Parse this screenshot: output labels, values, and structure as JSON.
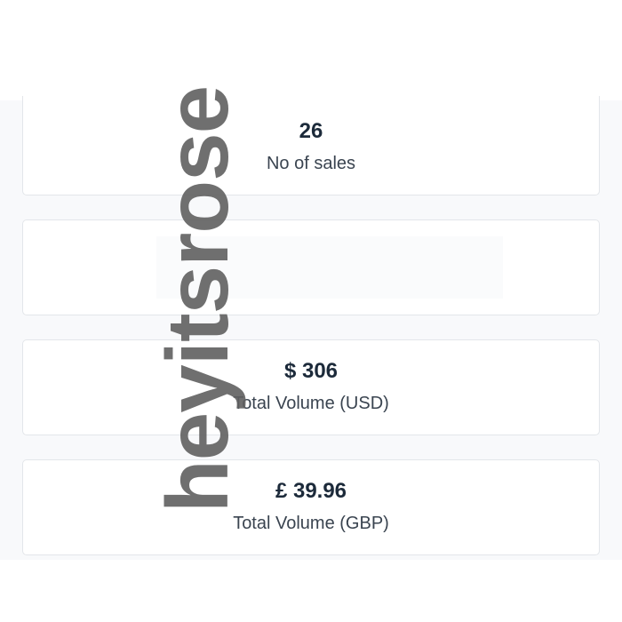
{
  "stats": [
    {
      "value": "26",
      "label": "No of sales"
    },
    {
      "value": "",
      "label": ""
    },
    {
      "value": "$ 306",
      "label": "Total Volume (USD)"
    },
    {
      "value": "£ 39.96",
      "label": "Total Volume (GBP)"
    }
  ],
  "watermark": {
    "text": "heyitsrose"
  },
  "colors": {
    "background": "#f8f9fb",
    "card": "#ffffff",
    "card_border": "#e3e6ea",
    "value_text": "#1c2a3a",
    "label_text": "#3a4450",
    "watermark": "#5f5f5f"
  }
}
